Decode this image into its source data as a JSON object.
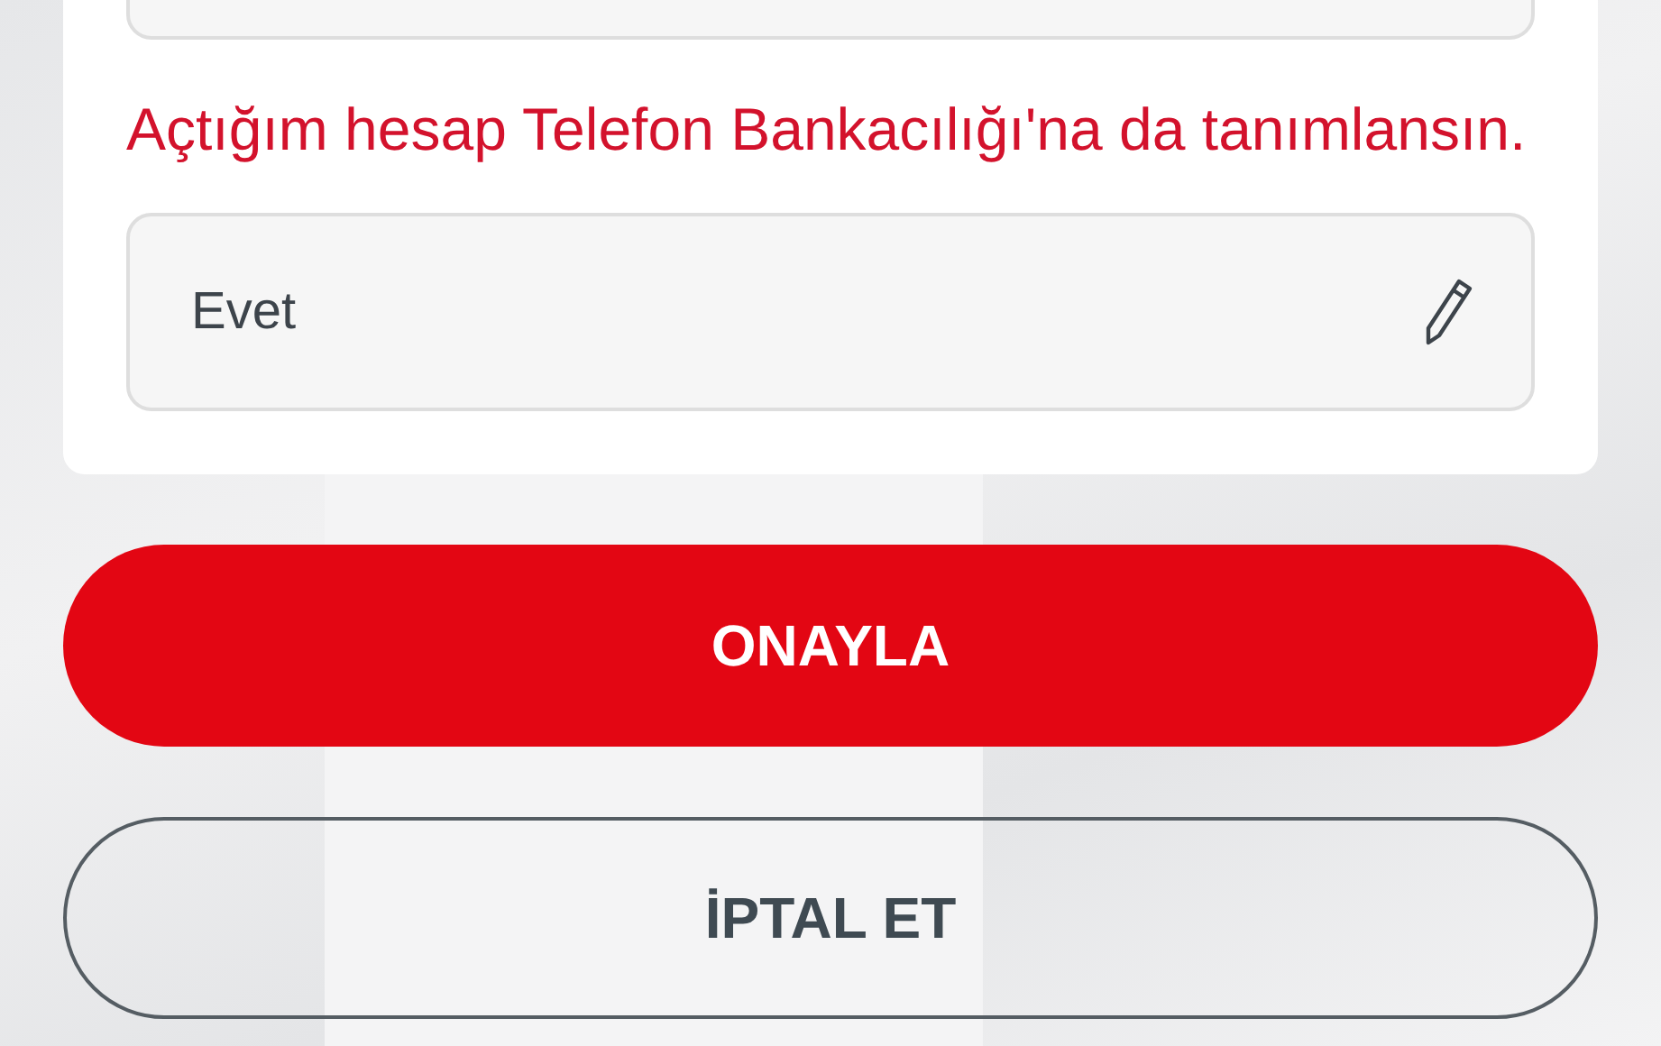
{
  "question": "Açtığım hesap Telefon Bankacılığı'na da tanımlansın.",
  "answer_field": {
    "value": "Evet"
  },
  "buttons": [
    {
      "label": "ONAYLA",
      "kind": "primary"
    },
    {
      "label": "İPTAL ET",
      "kind": "secondary"
    }
  ]
}
